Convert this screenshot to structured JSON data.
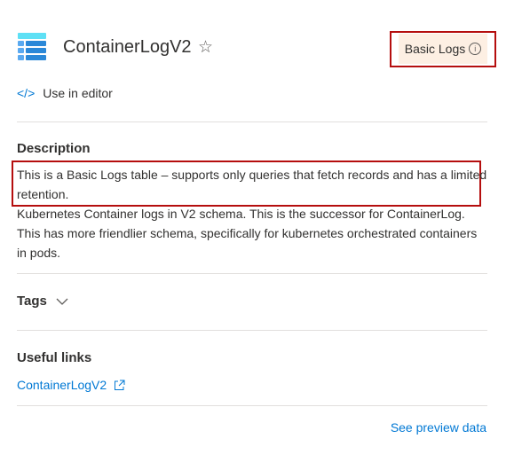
{
  "header": {
    "icon": "table-icon",
    "title": "ContainerLogV2",
    "favorite_icon": "star-icon",
    "badge": {
      "label": "Basic Logs",
      "icon": "info-icon",
      "bg": "#fdefe3"
    }
  },
  "use_in_editor": {
    "icon": "code-icon",
    "label": "Use in editor"
  },
  "description": {
    "heading": "Description",
    "highlight": "This is a Basic Logs table – supports only queries that fetch records and has a limited retention.",
    "body": "Kubernetes Container logs in V2 schema. This is the successor for ContainerLog. This has more friendlier schema, specifically for kubernetes orchestrated containers in pods."
  },
  "tags": {
    "label": "Tags",
    "icon": "chevron-down-icon"
  },
  "useful_links": {
    "heading": "Useful links",
    "links": [
      {
        "label": "ContainerLogV2",
        "icon": "external-link-icon"
      }
    ]
  },
  "footer": {
    "see_preview": "See preview data"
  },
  "colors": {
    "accent": "#0078d4",
    "highlight_border": "#b50e0e"
  }
}
